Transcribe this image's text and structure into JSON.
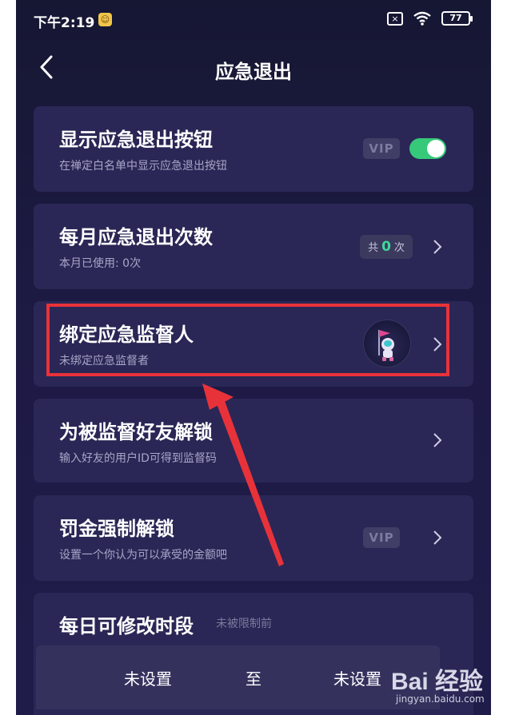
{
  "status_bar": {
    "time": "下午2:19",
    "battery": "77"
  },
  "header": {
    "title": "应急退出"
  },
  "cards": [
    {
      "title": "显示应急退出按钮",
      "subtitle": "在禅定白名单中显示应急退出按钮",
      "vip": "VIP",
      "toggle_on": true
    },
    {
      "title": "每月应急退出次数",
      "subtitle": "本月已使用: 0次",
      "count_prefix": "共",
      "count_value": "0",
      "count_suffix": "次"
    },
    {
      "title": "绑定应急监督人",
      "subtitle": "未绑定应急监督者"
    },
    {
      "title": "为被监督好友解锁",
      "subtitle": "输入好友的用户ID可得到监督码"
    },
    {
      "title": "罚金强制解锁",
      "subtitle": "设置一个你认为可以承受的金额吧",
      "vip": "VIP"
    },
    {
      "title": "每日可修改时段",
      "subtitle": "未被限制前"
    }
  ],
  "time_range": {
    "start": "未设置",
    "separator": "至",
    "end": "未设置"
  },
  "watermark": {
    "brand": "Bai 经验",
    "url": "jingyan.baidu.com"
  },
  "colors": {
    "highlight": "#e8323a",
    "toggle": "#36c97a",
    "accent_number": "#3fd99a"
  }
}
